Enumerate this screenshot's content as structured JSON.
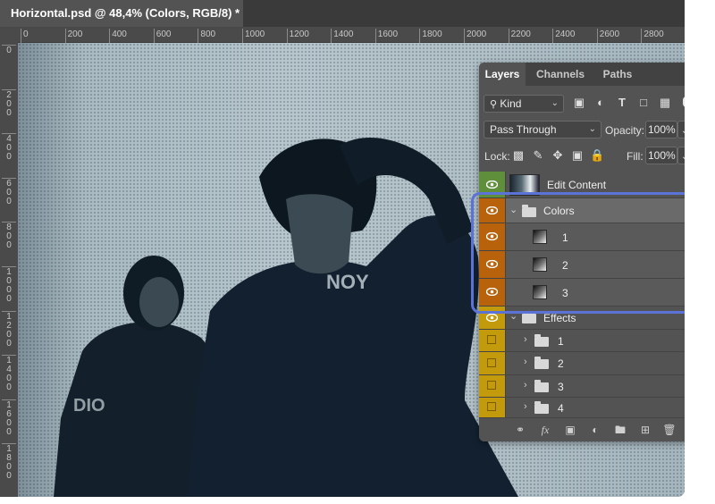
{
  "document": {
    "tab_title": "Horizontal.psd @ 48,4% (Colors, RGB/8) *"
  },
  "ruler": {
    "h_labels": [
      "0",
      "200",
      "400",
      "600",
      "800",
      "1000",
      "1200",
      "1400",
      "1600",
      "1800",
      "2000",
      "2200",
      "2400",
      "2600",
      "2800"
    ],
    "v_labels": [
      "0",
      "200",
      "400",
      "600",
      "800",
      "1000",
      "1200",
      "1400",
      "1600",
      "1800"
    ]
  },
  "layers_panel": {
    "tabs": [
      "Layers",
      "Channels",
      "Paths"
    ],
    "filter": {
      "label": "Kind"
    },
    "blend_mode": "Pass Through",
    "opacity_label": "Opacity:",
    "opacity_value": "100%",
    "lock_label": "Lock:",
    "fill_label": "Fill:",
    "fill_value": "100%",
    "layers": [
      {
        "name": "Edit Content",
        "type": "smart-object",
        "eye_color": "#5f8f3a"
      },
      {
        "name": "Colors",
        "type": "group-open",
        "eye_color": "#b8620c"
      },
      {
        "name": "1",
        "type": "gradient-fill",
        "eye_color": "#b8620c"
      },
      {
        "name": "2",
        "type": "gradient-fill",
        "eye_color": "#b8620c"
      },
      {
        "name": "3",
        "type": "gradient-fill",
        "eye_color": "#b8620c"
      },
      {
        "name": "Effects",
        "type": "group-open",
        "eye_color": "#c29a0c"
      },
      {
        "name": "1",
        "type": "group-closed",
        "eye_color": "#c29a0c"
      },
      {
        "name": "2",
        "type": "group-closed",
        "eye_color": "#c29a0c"
      },
      {
        "name": "3",
        "type": "group-closed",
        "eye_color": "#c29a0c"
      },
      {
        "name": "4",
        "type": "group-closed",
        "eye_color": "#c29a0c"
      }
    ],
    "footer_icons": [
      "link-icon",
      "fx-icon",
      "mask-icon",
      "adjustment-icon",
      "new-group-icon",
      "new-layer-icon",
      "trash-icon"
    ]
  },
  "colors": {
    "highlight": "#5b72d6",
    "panel_bg": "#535353"
  }
}
